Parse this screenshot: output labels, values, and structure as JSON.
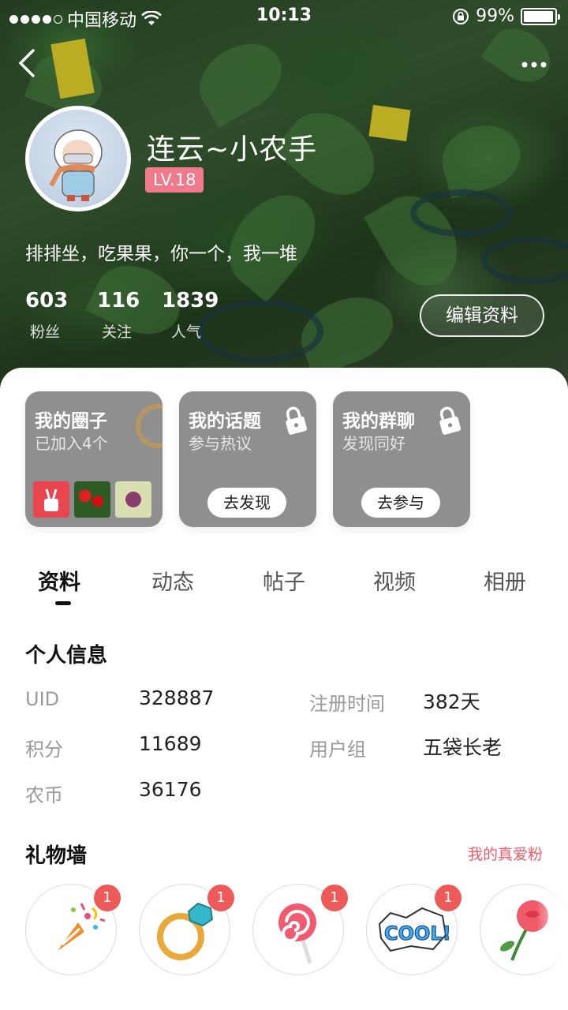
{
  "status": {
    "carrier": "中国移动",
    "time": "10:13",
    "battery": "99%"
  },
  "profile": {
    "name": "连云~小农手",
    "level": "LV.18",
    "bio": "排排坐，吃果果，你一个，我一堆",
    "stats": [
      {
        "num": "603",
        "label": "粉丝"
      },
      {
        "num": "116",
        "label": "关注"
      },
      {
        "num": "1839",
        "label": "人气"
      }
    ],
    "edit_label": "编辑资料"
  },
  "cards": [
    {
      "title": "我的圈子",
      "sub": "已加入4个"
    },
    {
      "title": "我的话题",
      "sub": "参与热议",
      "button": "去发现"
    },
    {
      "title": "我的群聊",
      "sub": "发现同好",
      "button": "去参与"
    }
  ],
  "tabs": [
    "资料",
    "动态",
    "帖子",
    "视频",
    "相册"
  ],
  "info": {
    "title": "个人信息",
    "rows": [
      {
        "key": "UID",
        "value": "328887"
      },
      {
        "key": "注册时间",
        "value": "382天"
      },
      {
        "key": "积分",
        "value": "11689"
      },
      {
        "key": "用户组",
        "value": "五袋长老"
      },
      {
        "key": "农币",
        "value": "36176"
      }
    ]
  },
  "gifts": {
    "title": "礼物墙",
    "link": "我的真爱粉",
    "items": [
      {
        "icon": "party-popper-icon",
        "count": "1"
      },
      {
        "icon": "diamond-ring-icon",
        "count": "1"
      },
      {
        "icon": "lollipop-icon",
        "count": "1"
      },
      {
        "icon": "cool-sticker-icon",
        "count": "1"
      },
      {
        "icon": "rose-icon",
        "count": ""
      }
    ]
  },
  "colors": {
    "accent": "#f05a6a",
    "level_badge": "#f07a8c",
    "card_bg": "#8f8f8f"
  }
}
